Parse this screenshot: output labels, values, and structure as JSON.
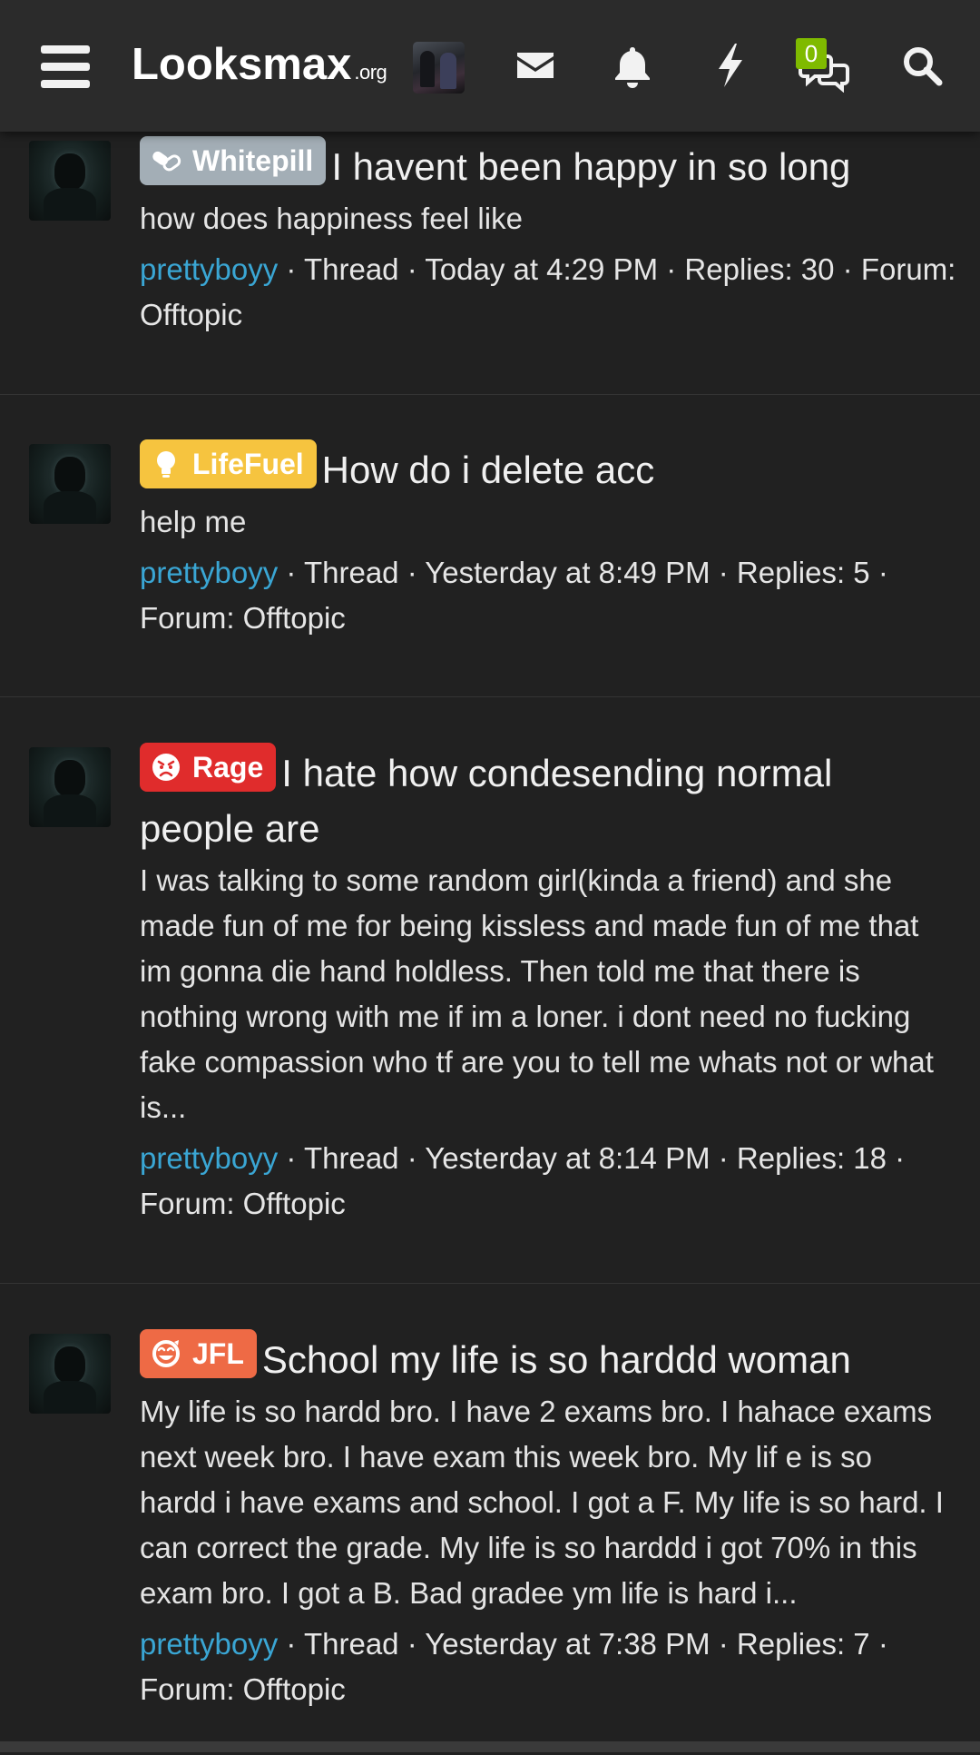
{
  "header": {
    "logo_main": "Looksmax",
    "logo_suffix": ".org",
    "chat_badge_count": "0",
    "icons": [
      "menu-icon",
      "mail-icon",
      "bell-icon",
      "lightning-icon",
      "chat-icon",
      "search-icon"
    ]
  },
  "colors": {
    "background": "#212121",
    "header": "#2b2b2b",
    "author_link": "#3aa6d4",
    "badge_green": "#7fba00",
    "whitepill": "#a3aeb6",
    "lifefuel": "#f6c43f",
    "rage": "#e02c2c",
    "jfl": "#ee6a45"
  },
  "threads": [
    {
      "prefix": "Whitepill",
      "prefix_icon": "pill-icon",
      "title": "I havent been happy in so long",
      "snippet": "how does happiness feel like",
      "author": "prettyboyy",
      "meta": " · Thread · Today at 4:29 PM · Replies: 30 · ",
      "forum": "Forum: Offtopic"
    },
    {
      "prefix": "LifeFuel",
      "prefix_icon": "lightbulb-icon",
      "title": "How do i delete acc",
      "snippet": "help me",
      "author": "prettyboyy",
      "meta": " · Thread · Yesterday at 8:49 PM · Replies: 5 · ",
      "forum": "Forum: Offtopic"
    },
    {
      "prefix": "Rage",
      "prefix_icon": "angry-face-icon",
      "title": "I hate how condesending normal people are",
      "snippet": "I was talking to some random girl(kinda a friend) and she made fun of me for being kissless and made fun of me that im gonna die hand holdless. Then told me that there is nothing wrong with me if im a loner. i dont need no fucking fake compassion who tf are you to tell me whats not or what is...",
      "author": "prettyboyy",
      "meta": " · Thread · Yesterday at 8:14 PM · Replies: 18 · ",
      "forum": "Forum: Offtopic"
    },
    {
      "prefix": "JFL",
      "prefix_icon": "laughing-face-icon",
      "title": "School my life is so harddd woman",
      "snippet": "My life is so hardd bro. I have 2 exams bro. I hahace exams next week bro. I have exam this week bro. My lif e is so hardd i have exams and school. I got a F. My life is so hard. I can correct the grade. My life is so harddd i got 70% in this exam bro. I got a B. Bad gradee ym life is hard i...",
      "author": "prettyboyy",
      "meta": " · Thread · Yesterday at 7:38 PM · Replies: 7 · ",
      "forum": "Forum: Offtopic"
    }
  ]
}
